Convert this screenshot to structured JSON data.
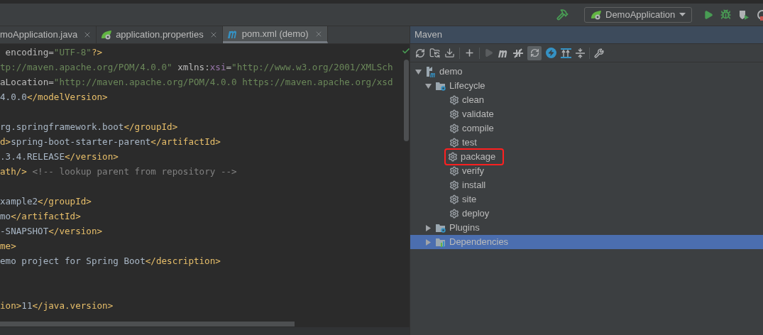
{
  "toolbar": {
    "run_config": "DemoApplication"
  },
  "tabs": [
    {
      "label": "moApplication.java",
      "kind": "java",
      "selected": false
    },
    {
      "label": "application.properties",
      "kind": "spring",
      "selected": false
    },
    {
      "label": "pom.xml (demo)",
      "kind": "maven",
      "selected": true
    }
  ],
  "editor": {
    "lines": [
      {
        "kind": "code",
        "segments": [
          {
            "kind": "attr",
            "text": " encoding"
          },
          {
            "kind": "plain",
            "text": "="
          },
          {
            "kind": "value",
            "text": "\"UTF-8\""
          },
          {
            "kind": "tag",
            "text": "?>"
          }
        ]
      },
      {
        "kind": "code",
        "segments": [
          {
            "kind": "value",
            "text": "tp://maven.apache.org/POM/4.0.0\""
          },
          {
            "kind": "plain",
            "text": " xmlns:"
          },
          {
            "kind": "ns",
            "text": "xsi"
          },
          {
            "kind": "plain",
            "text": "="
          },
          {
            "kind": "value",
            "text": "\"http://www.w3.org/2001/XMLSch"
          }
        ]
      },
      {
        "kind": "code",
        "segments": [
          {
            "kind": "attr",
            "text": "aLocation"
          },
          {
            "kind": "plain",
            "text": "="
          },
          {
            "kind": "value",
            "text": "\"http://maven.apache.org/POM/4.0.0 https://maven.apache.org/xsd"
          }
        ]
      },
      {
        "kind": "code",
        "segments": [
          {
            "kind": "text",
            "text": "4.0.0"
          },
          {
            "kind": "tag",
            "text": "</modelVersion>"
          }
        ]
      },
      {
        "kind": "blank"
      },
      {
        "kind": "code",
        "segments": [
          {
            "kind": "text",
            "text": "rg.springframework.boot"
          },
          {
            "kind": "tag",
            "text": "</groupId>"
          }
        ]
      },
      {
        "kind": "code",
        "segments": [
          {
            "kind": "tag",
            "text": "d>"
          },
          {
            "kind": "text",
            "text": "spring-boot-starter-parent"
          },
          {
            "kind": "tag",
            "text": "</artifactId>"
          }
        ]
      },
      {
        "kind": "code",
        "segments": [
          {
            "kind": "text",
            "text": ".3.4.RELEASE"
          },
          {
            "kind": "tag",
            "text": "</version>"
          }
        ]
      },
      {
        "kind": "code",
        "segments": [
          {
            "kind": "tag",
            "text": "ath/>"
          },
          {
            "kind": "comment",
            "text": " <!-- lookup parent from repository -->"
          }
        ]
      },
      {
        "kind": "blank"
      },
      {
        "kind": "code",
        "segments": [
          {
            "kind": "text",
            "text": "xample2"
          },
          {
            "kind": "tag",
            "text": "</groupId>"
          }
        ]
      },
      {
        "kind": "code",
        "segments": [
          {
            "kind": "text",
            "text": "mo"
          },
          {
            "kind": "tag",
            "text": "</artifactId>"
          }
        ]
      },
      {
        "kind": "code",
        "segments": [
          {
            "kind": "text",
            "text": "-SNAPSHOT"
          },
          {
            "kind": "tag",
            "text": "</version>"
          }
        ]
      },
      {
        "kind": "code",
        "segments": [
          {
            "kind": "tag",
            "text": "me>"
          }
        ]
      },
      {
        "kind": "code",
        "segments": [
          {
            "kind": "text",
            "text": "emo project for Spring Boot"
          },
          {
            "kind": "tag",
            "text": "</description>"
          }
        ]
      },
      {
        "kind": "blank"
      },
      {
        "kind": "blank"
      },
      {
        "kind": "code",
        "segments": [
          {
            "kind": "tag",
            "text": "ion>"
          },
          {
            "kind": "text",
            "text": "11"
          },
          {
            "kind": "tag",
            "text": "</java.version>"
          }
        ]
      }
    ]
  },
  "maven": {
    "title": "Maven",
    "tree": [
      {
        "label": "demo",
        "kind": "project",
        "expanded": true,
        "selected": false,
        "children": [
          {
            "label": "Lifecycle",
            "kind": "lifecycle",
            "expanded": true,
            "selected": false,
            "children": [
              {
                "label": "clean",
                "kind": "goal",
                "selected": false,
                "highlighted": false
              },
              {
                "label": "validate",
                "kind": "goal",
                "selected": false,
                "highlighted": false
              },
              {
                "label": "compile",
                "kind": "goal",
                "selected": false,
                "highlighted": false
              },
              {
                "label": "test",
                "kind": "goal",
                "selected": false,
                "highlighted": false
              },
              {
                "label": "package",
                "kind": "goal",
                "selected": false,
                "highlighted": true
              },
              {
                "label": "verify",
                "kind": "goal",
                "selected": false,
                "highlighted": false
              },
              {
                "label": "install",
                "kind": "goal",
                "selected": false,
                "highlighted": false
              },
              {
                "label": "site",
                "kind": "goal",
                "selected": false,
                "highlighted": false
              },
              {
                "label": "deploy",
                "kind": "goal",
                "selected": false,
                "highlighted": false
              }
            ]
          },
          {
            "label": "Plugins",
            "kind": "plugins",
            "expanded": false,
            "selected": false
          },
          {
            "label": "Dependencies",
            "kind": "dependencies",
            "expanded": false,
            "selected": true
          }
        ]
      }
    ]
  }
}
